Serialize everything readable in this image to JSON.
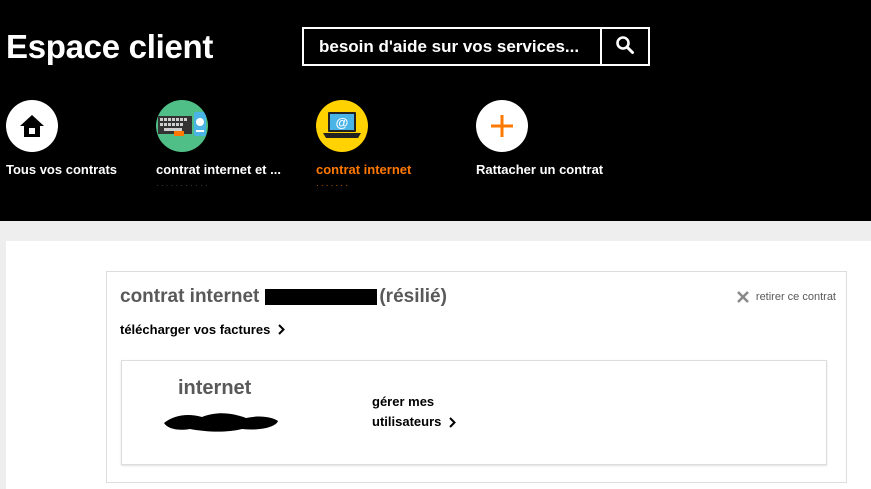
{
  "header": {
    "title": "Espace client",
    "search": {
      "placeholder": "besoin d'aide sur vos services...",
      "button_icon": "search-icon"
    }
  },
  "contracts": [
    {
      "label": "Tous vos contrats",
      "icon": "home-icon",
      "active": false
    },
    {
      "label": "contrat internet et ...",
      "icon": "keyboard-phone-icon",
      "active": false
    },
    {
      "label": "contrat internet",
      "icon": "laptop-email-icon",
      "active": true
    },
    {
      "label": "Rattacher un contrat",
      "icon": "plus-icon",
      "active": false
    }
  ],
  "card": {
    "title_prefix": "contrat internet",
    "title_suffix": "(résilié)",
    "remove_label": "retirer ce contrat",
    "invoices_label": "télécharger vos factures",
    "service": {
      "name": "internet",
      "manage_users_line1": "gérer mes",
      "manage_users_line2": "utilisateurs"
    }
  },
  "colors": {
    "accent": "#ff7900",
    "header_bg": "#000000",
    "text_grey": "#595959"
  }
}
